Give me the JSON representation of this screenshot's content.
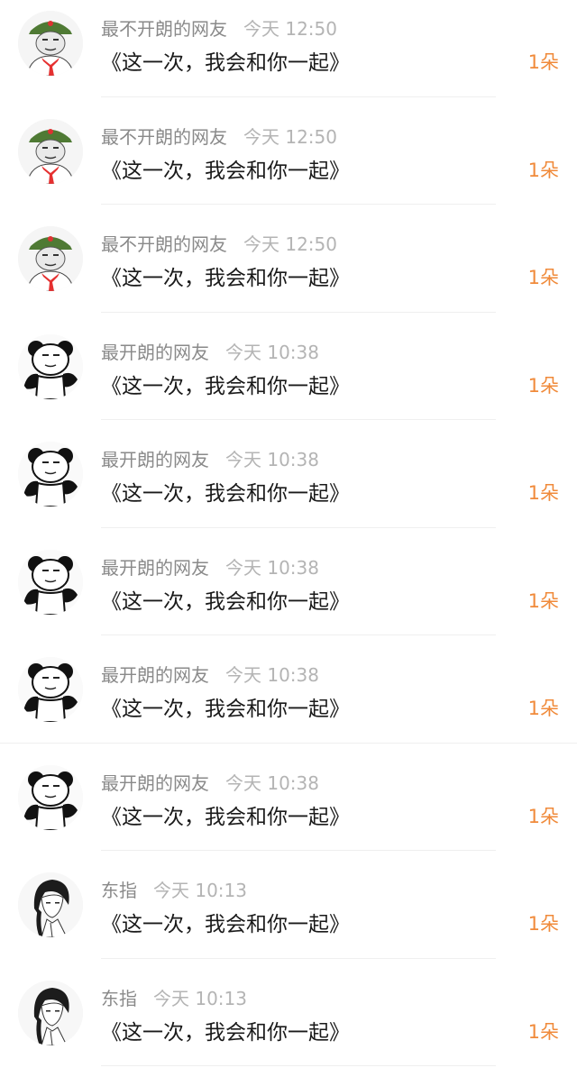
{
  "comments": [
    {
      "name": "最不开朗的网友",
      "time": "今天 12:50",
      "text": "《这一次，我会和你一起》",
      "count": "1朵",
      "avatar": "soldier-meme-avatar"
    },
    {
      "name": "最不开朗的网友",
      "time": "今天 12:50",
      "text": "《这一次，我会和你一起》",
      "count": "1朵",
      "avatar": "soldier-meme-avatar"
    },
    {
      "name": "最不开朗的网友",
      "time": "今天 12:50",
      "text": "《这一次，我会和你一起》",
      "count": "1朵",
      "avatar": "soldier-meme-avatar"
    },
    {
      "name": "最开朗的网友",
      "time": "今天 10:38",
      "text": "《这一次，我会和你一起》",
      "count": "1朵",
      "avatar": "panda-meme-avatar"
    },
    {
      "name": "最开朗的网友",
      "time": "今天 10:38",
      "text": "《这一次，我会和你一起》",
      "count": "1朵",
      "avatar": "panda-meme-avatar"
    },
    {
      "name": "最开朗的网友",
      "time": "今天 10:38",
      "text": "《这一次，我会和你一起》",
      "count": "1朵",
      "avatar": "panda-meme-avatar"
    },
    {
      "name": "最开朗的网友",
      "time": "今天 10:38",
      "text": "《这一次，我会和你一起》",
      "count": "1朵",
      "avatar": "panda-meme-avatar"
    },
    {
      "name": "最开朗的网友",
      "time": "今天 10:38",
      "text": "《这一次，我会和你一起》",
      "count": "1朵",
      "avatar": "panda-meme-avatar"
    },
    {
      "name": "东指",
      "time": "今天 10:13",
      "text": "《这一次，我会和你一起》",
      "count": "1朵",
      "avatar": "anime-character-avatar"
    },
    {
      "name": "东指",
      "time": "今天 10:13",
      "text": "《这一次，我会和你一起》",
      "count": "1朵",
      "avatar": "anime-character-avatar"
    }
  ],
  "colors": {
    "name": "#8a8a8a",
    "time": "#b4b4b4",
    "text": "#1a1a1a",
    "count": "#f08a3a",
    "divider": "#efefef"
  }
}
